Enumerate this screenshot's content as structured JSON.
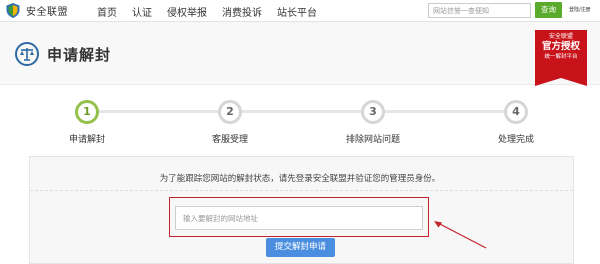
{
  "topbar": {
    "logo_text": "安全联盟",
    "nav": [
      {
        "label": "首页"
      },
      {
        "label": "认证"
      },
      {
        "label": "侵权举报"
      },
      {
        "label": "消费投诉"
      },
      {
        "label": "站长平台"
      }
    ],
    "search_placeholder": "网站信誉一查便知",
    "search_button": "查询",
    "user_link": "登陆/注册"
  },
  "header": {
    "title": "申请解封",
    "ribbon": {
      "top": "安全联盟",
      "mid": "官方授权",
      "bottom": "统一解封平台"
    }
  },
  "steps": [
    {
      "number": "1",
      "label": "申请解封",
      "active": true
    },
    {
      "number": "2",
      "label": "客服受理",
      "active": false
    },
    {
      "number": "3",
      "label": "排除网站问题",
      "active": false
    },
    {
      "number": "4",
      "label": "处理完成",
      "active": false
    }
  ],
  "main": {
    "notice": "为了能跟踪您网站的解封状态，请先登录安全联盟并验证您的管理员身份。",
    "url_placeholder": "输入要解封的网站地址",
    "submit_label": "提交解封申请"
  },
  "colors": {
    "brand_green": "#5aab2b",
    "step_active": "#93c24a",
    "ribbon_red": "#c9131b",
    "highlight_red": "#c0232b",
    "submit_blue": "#4b8ee0"
  }
}
